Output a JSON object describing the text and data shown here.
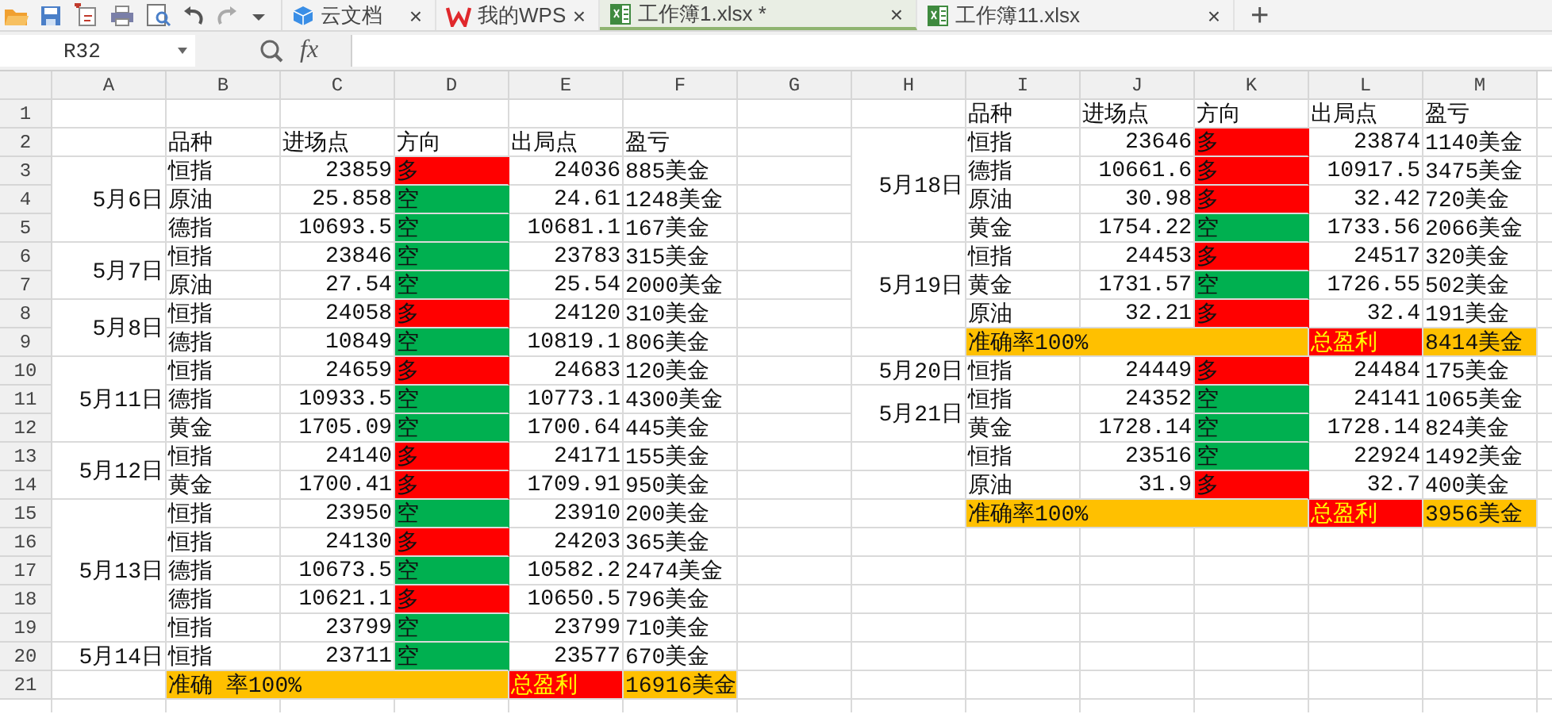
{
  "tabbar": {
    "tabs": [
      {
        "kind": "cloud",
        "label": "云文档",
        "close": "×",
        "selected": false
      },
      {
        "kind": "wps",
        "label": "我的WPS",
        "close": "×",
        "selected": false
      },
      {
        "kind": "workbook",
        "label": "工作簿1.xlsx *",
        "close": "×",
        "selected": true
      },
      {
        "kind": "workbook",
        "label": "工作簿11.xlsx",
        "close": "×",
        "selected": false
      }
    ],
    "new_tab": "+"
  },
  "formula_bar": {
    "name_box": "R32",
    "fx": "fx"
  },
  "columns": [
    "A",
    "B",
    "C",
    "D",
    "E",
    "F",
    "G",
    "H",
    "I",
    "J",
    "K",
    "L",
    "M"
  ],
  "rows": [
    "1",
    "2",
    "3",
    "4",
    "5",
    "6",
    "7",
    "8",
    "9",
    "10",
    "11",
    "12",
    "13",
    "14",
    "15",
    "16",
    "17",
    "18",
    "19",
    "20",
    "21"
  ],
  "tables": [
    {
      "headers": [
        "品种",
        "进场点",
        "方向",
        "出局点",
        "盈亏"
      ],
      "sections": [
        {
          "kind": "group",
          "date": "5月6日",
          "trades": [
            {
              "product": "恒指",
              "entry": "23859",
              "direction": "多",
              "color": "#ff0000",
              "exit": "24036",
              "pnl": "885美金"
            },
            {
              "product": "原油",
              "entry": "25.858",
              "direction": "空",
              "color": "#00b050",
              "exit": "24.61",
              "pnl": "1248美金"
            },
            {
              "product": "德指",
              "entry": "10693.5",
              "direction": "空",
              "color": "#00b050",
              "exit": "10681.1",
              "pnl": "167美金"
            }
          ]
        },
        {
          "kind": "group",
          "date": "5月7日",
          "trades": [
            {
              "product": "恒指",
              "entry": "23846",
              "direction": "空",
              "color": "#00b050",
              "exit": "23783",
              "pnl": "315美金"
            },
            {
              "product": "原油",
              "entry": "27.54",
              "direction": "空",
              "color": "#00b050",
              "exit": "25.54",
              "pnl": "2000美金"
            }
          ]
        },
        {
          "kind": "group",
          "date": "5月8日",
          "trades": [
            {
              "product": "恒指",
              "entry": "24058",
              "direction": "多",
              "color": "#ff0000",
              "exit": "24120",
              "pnl": "310美金"
            },
            {
              "product": "德指",
              "entry": "10849",
              "direction": "空",
              "color": "#00b050",
              "exit": "10819.1",
              "pnl": "806美金"
            }
          ]
        },
        {
          "kind": "group",
          "date": "5月11日",
          "trades": [
            {
              "product": "恒指",
              "entry": "24659",
              "direction": "多",
              "color": "#ff0000",
              "exit": "24683",
              "pnl": "120美金"
            },
            {
              "product": "德指",
              "entry": "10933.5",
              "direction": "空",
              "color": "#00b050",
              "exit": "10773.1",
              "pnl": "4300美金"
            },
            {
              "product": "黄金",
              "entry": "1705.09",
              "direction": "空",
              "color": "#00b050",
              "exit": "1700.64",
              "pnl": "445美金"
            }
          ]
        },
        {
          "kind": "group",
          "date": "5月12日",
          "trades": [
            {
              "product": "恒指",
              "entry": "24140",
              "direction": "多",
              "color": "#ff0000",
              "exit": "24171",
              "pnl": "155美金"
            },
            {
              "product": "黄金",
              "entry": "1700.41",
              "direction": "多",
              "color": "#ff0000",
              "exit": "1709.91",
              "pnl": "950美金"
            }
          ]
        },
        {
          "kind": "group",
          "date": "5月13日",
          "trades": [
            {
              "product": "恒指",
              "entry": "23950",
              "direction": "空",
              "color": "#00b050",
              "exit": "23910",
              "pnl": "200美金"
            },
            {
              "product": "恒指",
              "entry": "24130",
              "direction": "多",
              "color": "#ff0000",
              "exit": "24203",
              "pnl": "365美金"
            },
            {
              "product": "德指",
              "entry": "10673.5",
              "direction": "空",
              "color": "#00b050",
              "exit": "10582.2",
              "pnl": "2474美金"
            },
            {
              "product": "德指",
              "entry": "10621.1",
              "direction": "多",
              "color": "#ff0000",
              "exit": "10650.5",
              "pnl": "796美金"
            },
            {
              "product": "恒指",
              "entry": "23799",
              "direction": "空",
              "color": "#00b050",
              "exit": "23799",
              "pnl": "710美金"
            }
          ]
        },
        {
          "kind": "group",
          "date": "5月14日",
          "trades": [
            {
              "product": "恒指",
              "entry": "23711",
              "direction": "空",
              "color": "#00b050",
              "exit": "23577",
              "pnl": "670美金"
            }
          ]
        },
        {
          "kind": "summary",
          "accuracy": "准确 率100%",
          "total_label": "总盈利",
          "total": "16916美金"
        }
      ]
    },
    {
      "headers": [
        "品种",
        "进场点",
        "方向",
        "出局点",
        "盈亏"
      ],
      "sections": [
        {
          "kind": "group",
          "date": "5月18日",
          "trades": [
            {
              "product": "恒指",
              "entry": "23646",
              "direction": "多",
              "color": "#ff0000",
              "exit": "23874",
              "pnl": "1140美金"
            },
            {
              "product": "德指",
              "entry": "10661.6",
              "direction": "多",
              "color": "#ff0000",
              "exit": "10917.5",
              "pnl": "3475美金"
            },
            {
              "product": "原油",
              "entry": "30.98",
              "direction": "多",
              "color": "#ff0000",
              "exit": "32.42",
              "pnl": "720美金"
            },
            {
              "product": "黄金",
              "entry": "1754.22",
              "direction": "空",
              "color": "#00b050",
              "exit": "1733.56",
              "pnl": "2066美金"
            }
          ]
        },
        {
          "kind": "group",
          "date": "5月19日",
          "trades": [
            {
              "product": "恒指",
              "entry": "24453",
              "direction": "多",
              "color": "#ff0000",
              "exit": "24517",
              "pnl": "320美金"
            },
            {
              "product": "黄金",
              "entry": "1731.57",
              "direction": "空",
              "color": "#00b050",
              "exit": "1726.55",
              "pnl": "502美金"
            },
            {
              "product": "原油",
              "entry": "32.21",
              "direction": "多",
              "color": "#ff0000",
              "exit": "32.4",
              "pnl": "191美金"
            }
          ]
        },
        {
          "kind": "summary",
          "accuracy": "准确率100%",
          "total_label": "总盈利",
          "total": "8414美金"
        },
        {
          "kind": "group",
          "date": "5月20日",
          "trades": [
            {
              "product": "恒指",
              "entry": "24449",
              "direction": "多",
              "color": "#ff0000",
              "exit": "24484",
              "pnl": "175美金"
            }
          ]
        },
        {
          "kind": "group",
          "date": "5月21日",
          "trades": [
            {
              "product": "恒指",
              "entry": "24352",
              "direction": "空",
              "color": "#00b050",
              "exit": "24141",
              "pnl": "1065美金"
            },
            {
              "product": "黄金",
              "entry": "1728.14",
              "direction": "空",
              "color": "#00b050",
              "exit": "1728.14",
              "pnl": "824美金"
            }
          ]
        },
        {
          "kind": "group",
          "trades": [
            {
              "product": "恒指",
              "entry": "23516",
              "direction": "空",
              "color": "#00b050",
              "exit": "22924",
              "pnl": "1492美金"
            }
          ]
        },
        {
          "kind": "group",
          "trades": [
            {
              "product": "原油",
              "entry": "31.9",
              "direction": "多",
              "color": "#ff0000",
              "exit": "32.7",
              "pnl": "400美金"
            }
          ]
        },
        {
          "kind": "summary",
          "accuracy": "准确率100%",
          "total_label": "总盈利",
          "total": "3956美金"
        }
      ]
    }
  ]
}
